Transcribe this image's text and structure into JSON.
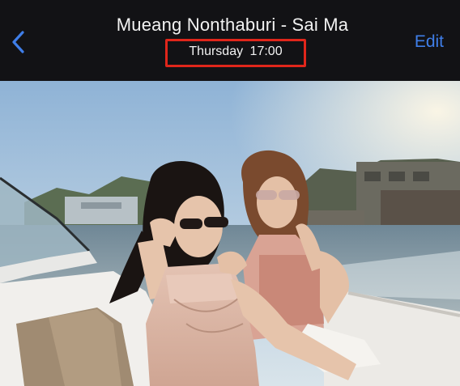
{
  "header": {
    "title": "Mueang Nonthaburi - Sai Ma",
    "subtitle": "Thursday  17:00",
    "edit_label": "Edit"
  },
  "colors": {
    "header_bg": "#121215",
    "accent": "#3f7ee8",
    "highlight_box": "#e0261b"
  },
  "icons": {
    "back": "chevron-left-icon"
  }
}
